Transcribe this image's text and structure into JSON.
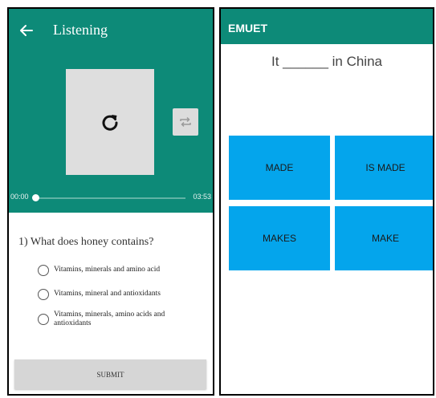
{
  "listening_app": {
    "title": "Listening",
    "player": {
      "current_time": "00:00",
      "total_time": "03:53",
      "progress_fraction": 0.0
    },
    "question": {
      "text": "1) What does honey contains?",
      "options": [
        "Vitamins, minerals and amino acid",
        "Vitamins, mineral and antioxidants",
        "Vitamins, minerals, amino acids and antioxidants"
      ]
    },
    "submit_label": "SUBMIT"
  },
  "quiz_app": {
    "title": "EMUET",
    "sentence": "It ______ in China",
    "choices": [
      "MADE",
      "IS MADE",
      "MAKES",
      "MAKE"
    ]
  },
  "colors": {
    "primary": "#0d8a78",
    "choice_button": "#04a5ec",
    "player_box": "#dedede"
  }
}
